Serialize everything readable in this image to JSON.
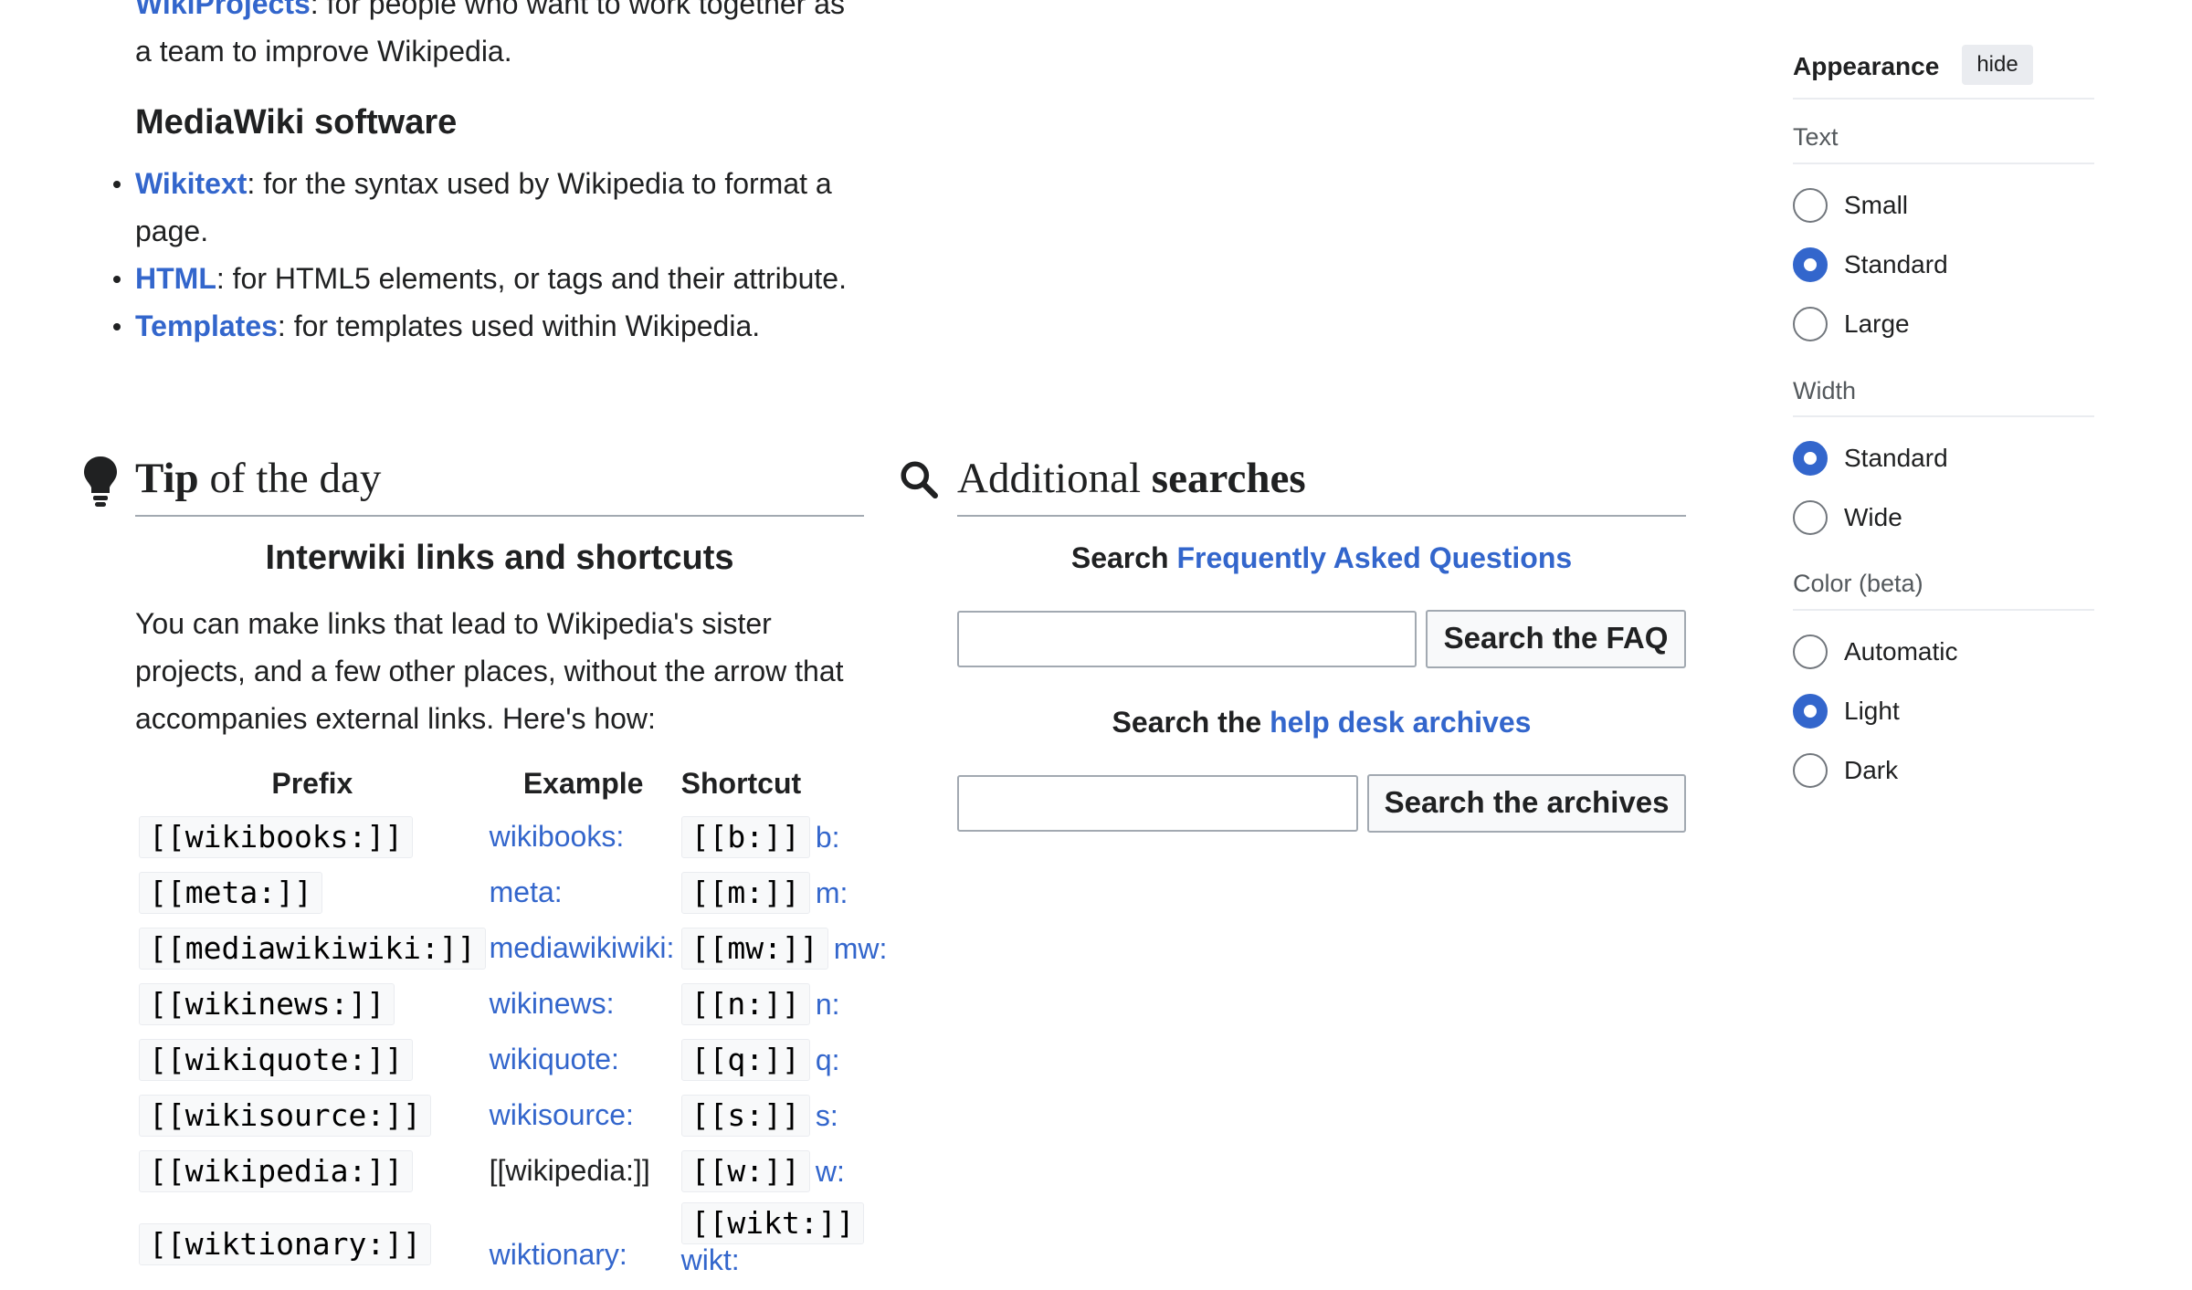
{
  "top": {
    "wikiprojects_link": "WikiProjects",
    "wikiprojects_text": ": for people who want to work together as a team to improve Wikipedia."
  },
  "mediawiki": {
    "heading": "MediaWiki software",
    "items": [
      {
        "link": "Wikitext",
        "text": ": for the syntax used by Wikipedia to format a page."
      },
      {
        "link": "HTML",
        "text": ": for HTML5 elements, or tags and their attribute."
      },
      {
        "link": "Templates",
        "text": ": for templates used within Wikipedia."
      }
    ]
  },
  "tip": {
    "heading_bold": "Tip",
    "heading_rest": " of the day",
    "title": "Interwiki links and shortcuts",
    "body": "You can make links that lead to Wikipedia's sister projects, and a few other places, without the arrow that accompanies external links. Here's how:",
    "table": {
      "headers": [
        "Prefix",
        "Example",
        "Shortcut"
      ],
      "rows": [
        {
          "prefix": "[[wikibooks:]]",
          "example": "wikibooks:",
          "example_link": true,
          "shortcut": "[[b:]]",
          "short": "b:"
        },
        {
          "prefix": "[[meta:]]",
          "example": "meta:",
          "example_link": true,
          "shortcut": "[[m:]]",
          "short": "m:"
        },
        {
          "prefix": "[[mediawikiwiki:]]",
          "example": "mediawikiwiki:",
          "example_link": true,
          "shortcut": "[[mw:]]",
          "short": "mw:"
        },
        {
          "prefix": "[[wikinews:]]",
          "example": "wikinews:",
          "example_link": true,
          "shortcut": "[[n:]]",
          "short": "n:"
        },
        {
          "prefix": "[[wikiquote:]]",
          "example": "wikiquote:",
          "example_link": true,
          "shortcut": "[[q:]]",
          "short": "q:"
        },
        {
          "prefix": "[[wikisource:]]",
          "example": "wikisource:",
          "example_link": true,
          "shortcut": "[[s:]]",
          "short": "s:"
        },
        {
          "prefix": "[[wikipedia:]]",
          "example": "[[wikipedia:]]",
          "example_link": false,
          "shortcut": "[[w:]]",
          "short": "w:"
        },
        {
          "prefix": "[[wiktionary:]]",
          "example": "wiktionary:",
          "example_link": true,
          "shortcut": "[[wikt:]]",
          "short": "wikt:"
        }
      ]
    }
  },
  "searches": {
    "heading_normal": "Additional ",
    "heading_bold": "searches",
    "faq": {
      "prefix": "Search ",
      "link": "Frequently Asked Questions",
      "button": "Search the FAQ",
      "value": ""
    },
    "archives": {
      "prefix": "Search the ",
      "link": "help desk archives",
      "button": "Search the archives",
      "value": ""
    }
  },
  "appearance": {
    "title": "Appearance",
    "hide": "hide",
    "text_label": "Text",
    "text_options": [
      {
        "label": "Small",
        "selected": false
      },
      {
        "label": "Standard",
        "selected": true
      },
      {
        "label": "Large",
        "selected": false
      }
    ],
    "width_label": "Width",
    "width_options": [
      {
        "label": "Standard",
        "selected": true
      },
      {
        "label": "Wide",
        "selected": false
      }
    ],
    "color_label": "Color (beta)",
    "color_options": [
      {
        "label": "Automatic",
        "selected": false
      },
      {
        "label": "Light",
        "selected": true
      },
      {
        "label": "Dark",
        "selected": false
      }
    ]
  },
  "colors": {
    "link": "#3366cc",
    "accent": "#3366cc",
    "text": "#202122",
    "border": "#a2a9b1"
  },
  "icons": {
    "tip": "lightbulb-icon",
    "search": "magnifier-icon"
  }
}
